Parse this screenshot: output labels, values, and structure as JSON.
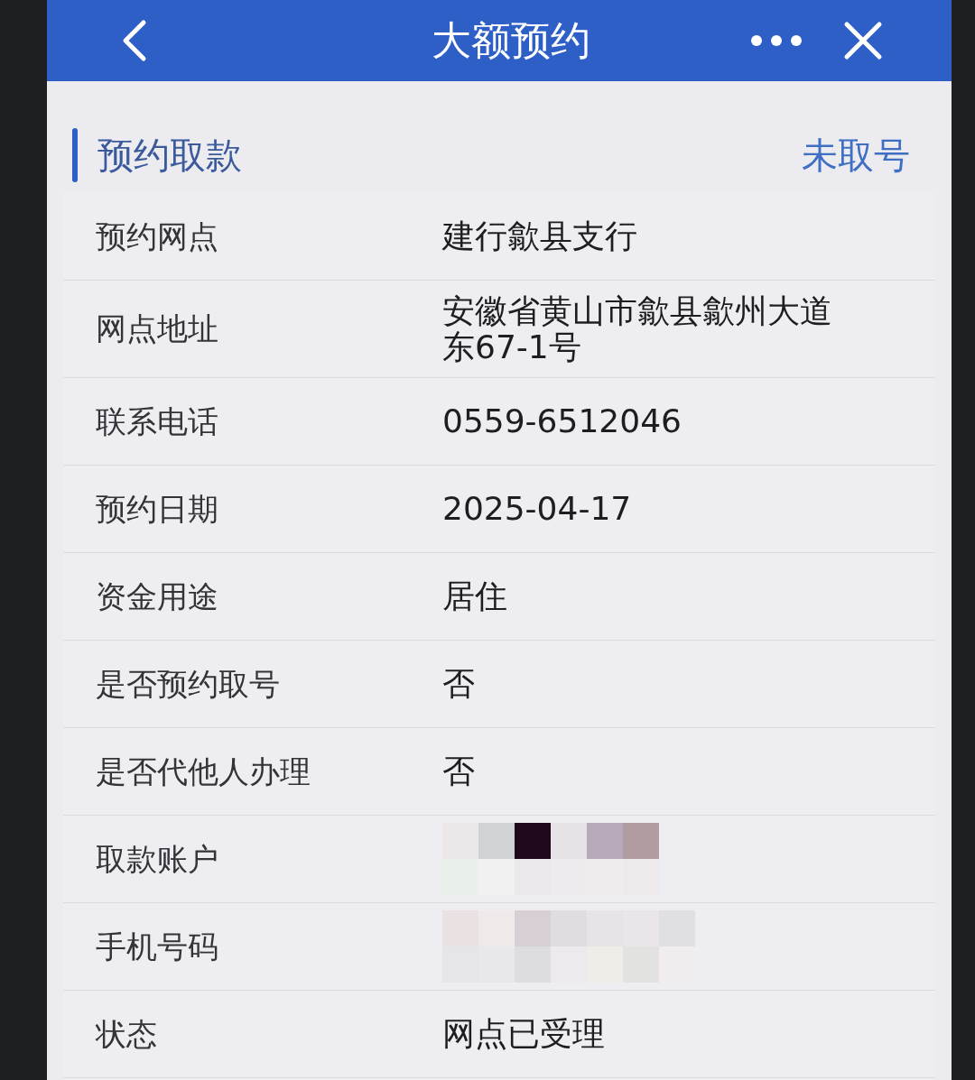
{
  "header": {
    "title": "大额预约"
  },
  "section": {
    "title": "预约取款",
    "status": "未取号"
  },
  "rows": [
    {
      "label": "预约网点",
      "kind": "text",
      "value": "建行歙县支行"
    },
    {
      "label": "网点地址",
      "kind": "text",
      "value": "安徽省黄山市歙县歙州大道东67-1号"
    },
    {
      "label": "联系电话",
      "kind": "text",
      "value": "0559-6512046"
    },
    {
      "label": "预约日期",
      "kind": "text",
      "value": "2025-04-17"
    },
    {
      "label": "资金用途",
      "kind": "text",
      "value": "居住"
    },
    {
      "label": "是否预约取号",
      "kind": "text",
      "value": "否"
    },
    {
      "label": "是否代他人办理",
      "kind": "text",
      "value": "否"
    },
    {
      "label": "取款账户",
      "kind": "redacted"
    },
    {
      "label": "手机号码",
      "kind": "redacted"
    },
    {
      "label": "状态",
      "kind": "text",
      "value": "网点已受理"
    }
  ]
}
